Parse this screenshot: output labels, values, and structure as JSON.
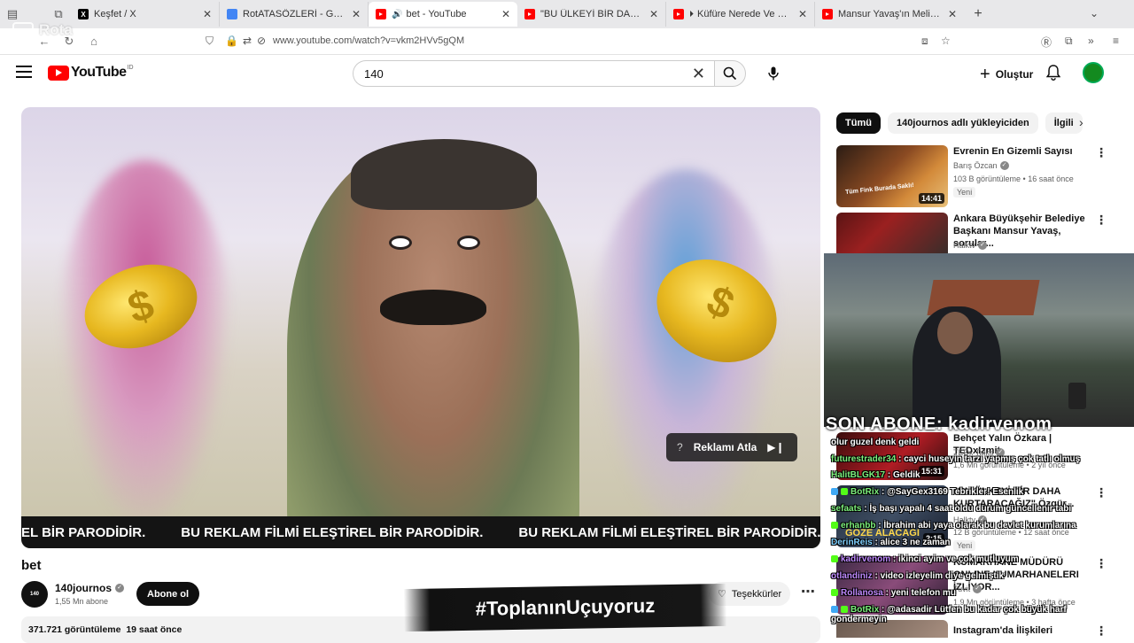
{
  "browser": {
    "tabs": [
      {
        "title": "Keşfet / X",
        "favicon": "x-icon"
      },
      {
        "title": "RotATASÖZLERİ - Google Dokü",
        "favicon": "docs-icon"
      },
      {
        "title": "bet - YouTube",
        "favicon": "youtube-icon",
        "active": true
      },
      {
        "title": "\"BU ÜLKEYİ BİR DAHA KURTAR",
        "favicon": "youtube-icon"
      },
      {
        "title": "Küfüre Nerede Ve Nasıl İhtiy",
        "favicon": "youtube-icon"
      },
      {
        "title": "Mansur Yavaş'ın Melih Gökçek C",
        "favicon": "youtube-icon"
      }
    ],
    "url": "www.youtube.com/watch?v=vkm2HVv5gQM",
    "overlay_brand": "Rota"
  },
  "header": {
    "logo": "YouTube",
    "logo_region": "ID",
    "search_value": "140",
    "create_label": "Oluştur"
  },
  "player": {
    "skip_label": "Reklamı Atla",
    "skip_info": "?",
    "banner_text": [
      "EL BİR PARODİDİR.",
      "BU REKLAM FİLMİ ELEŞTİREL BİR PARODİDİR.",
      "BU REKLAM FİLMİ ELEŞTİREL BİR PARODİDİR."
    ]
  },
  "video": {
    "title": "bet",
    "channel": "140journos",
    "subscribers": "1,55 Mn abone",
    "subscribe_label": "Abone ol",
    "thanks_label": "Teşekkürler",
    "views": "371.721 görüntüleme",
    "age": "19 saat önce"
  },
  "hashtag_banner": "#ToplanınUçuyoruz",
  "sidebar": {
    "chips": [
      "Tümü",
      "140journos adlı yükleyiciden",
      "İlgili"
    ],
    "recommendations": [
      {
        "title": "Evrenin En Gizemli Sayısı",
        "channel": "Barış Özcan",
        "meta": "103 B görüntüleme • 16 saat önce",
        "badge": "Yeni",
        "duration": "14:41",
        "thumb_text": "Tüm Fink Burada Saklı!"
      },
      {
        "title": "Ankara Büyükşehir Belediye Başkanı Mansur Yavaş, sorular...",
        "channel": "Halktv"
      },
      {
        "title": "Behçet Yalın Özkara | TEDxIzmit",
        "channel": "TEDx Talks",
        "meta": "1,6 Mn görüntüleme • 2 yıl önce",
        "duration": "15:31"
      },
      {
        "title": "\"BU ÜLKEYİ BİR DAHA KURTARACAĞIZ\" Özgür...",
        "channel": "Halktv",
        "meta": "12 B görüntüleme • 12 saat önce",
        "badge": "Yeni",
        "duration": "2:15",
        "thumb_text": "GÖZE ALACAĞI"
      },
      {
        "title": "KUMARHANE MÜDÜRÜ ONLINE KUMARHANELERI İZLİYOR...",
        "channel": "Tuvit",
        "meta": "1,9 Mn görüntüleme • 3 hafta önce"
      },
      {
        "title": "Instagram'da İlişkileri"
      }
    ]
  },
  "stream_overlay": {
    "banner": "SON ABONE: kadirvenom",
    "chat": [
      {
        "user": "",
        "text": "olur guzel denk geldi"
      },
      {
        "user": "futurestrader34",
        "text": "cayci huseyin tarzı yapmış çok tatlı olmuş"
      },
      {
        "user": "HalitBLGK17",
        "text": "Geldik"
      },
      {
        "user": "BotRix",
        "text": "@SayGex3169 Tebrikler! Esenlik"
      },
      {
        "user": "sefaats",
        "text": "İş başı yapalı 4 saat oldu durum güncellenir tabi"
      },
      {
        "user": "erhanbb",
        "text": "İbrahim abi yaya olarak bu devlet kurumlarına"
      },
      {
        "user": "DerinReis",
        "text": "alice 3 ne zaman"
      },
      {
        "user": "kadirvenom",
        "text": "ikinci ayim ve çok mutluyum"
      },
      {
        "user": "otlandiniz",
        "text": "video izleyelim diye gelmiştik"
      },
      {
        "user": "Rollanosa",
        "text": "yeni telefon mu"
      },
      {
        "user": "BotRix",
        "text": "@adasadir Lütfen bu kadar çok büyük harf gondermeyin"
      }
    ]
  }
}
